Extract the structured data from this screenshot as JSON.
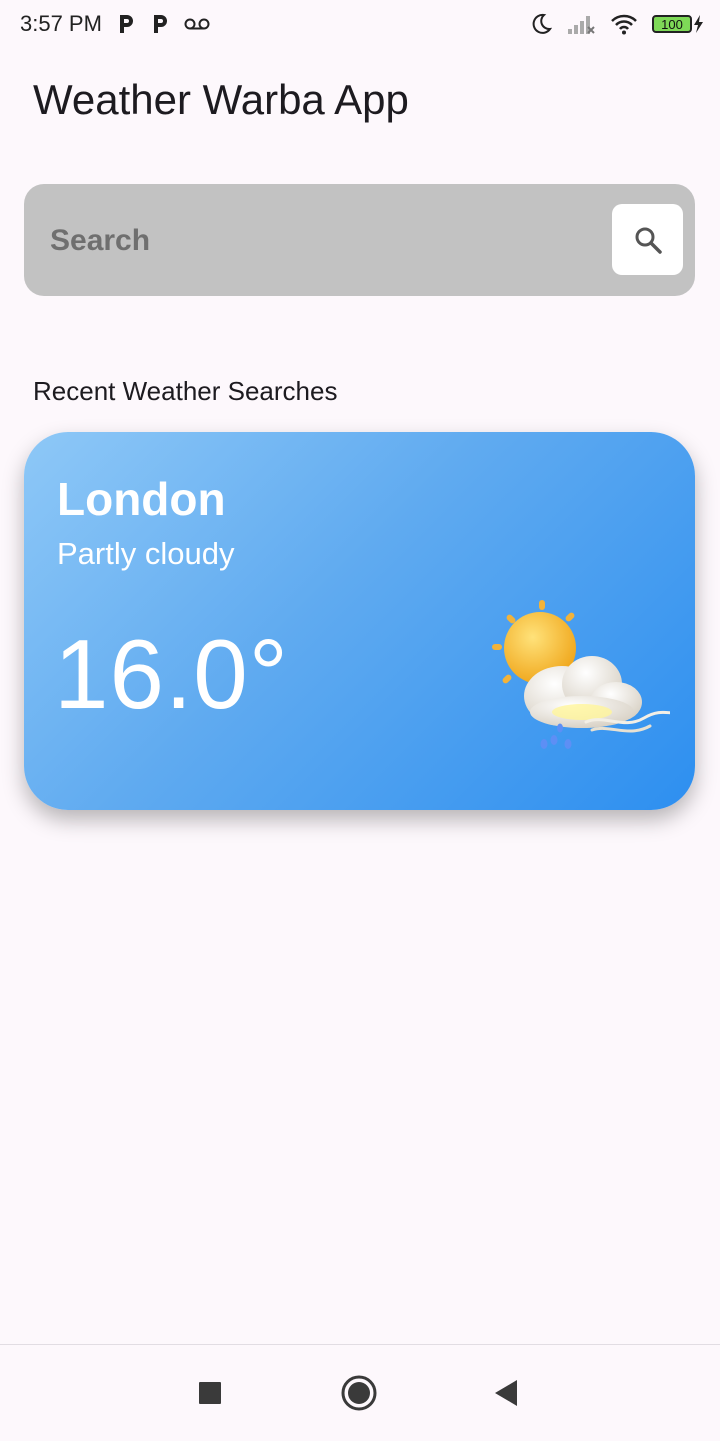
{
  "status_bar": {
    "time": "3:57 PM",
    "battery_level": "100",
    "icons": [
      "parking-icon",
      "parking-icon",
      "voicemail-icon",
      "moon-icon",
      "signal-icon",
      "wifi-icon",
      "battery-icon",
      "charging-icon"
    ]
  },
  "app": {
    "title": "Weather Warba App"
  },
  "search": {
    "placeholder": "Search",
    "value": "",
    "button_icon": "search-icon"
  },
  "recent": {
    "heading": "Recent Weather Searches",
    "cards": [
      {
        "city": "London",
        "condition": "Partly cloudy",
        "temperature": "16.0°",
        "icon": "partly-cloudy-rain-icon"
      }
    ]
  },
  "colors": {
    "background": "#fdf8fc",
    "search_bar": "#c2c2c2",
    "card_gradient_start": "#8ec8f7",
    "card_gradient_end": "#2d8ff0"
  },
  "nav_bar": {
    "icons": [
      "recents-square-icon",
      "home-circle-icon",
      "back-triangle-icon"
    ]
  }
}
